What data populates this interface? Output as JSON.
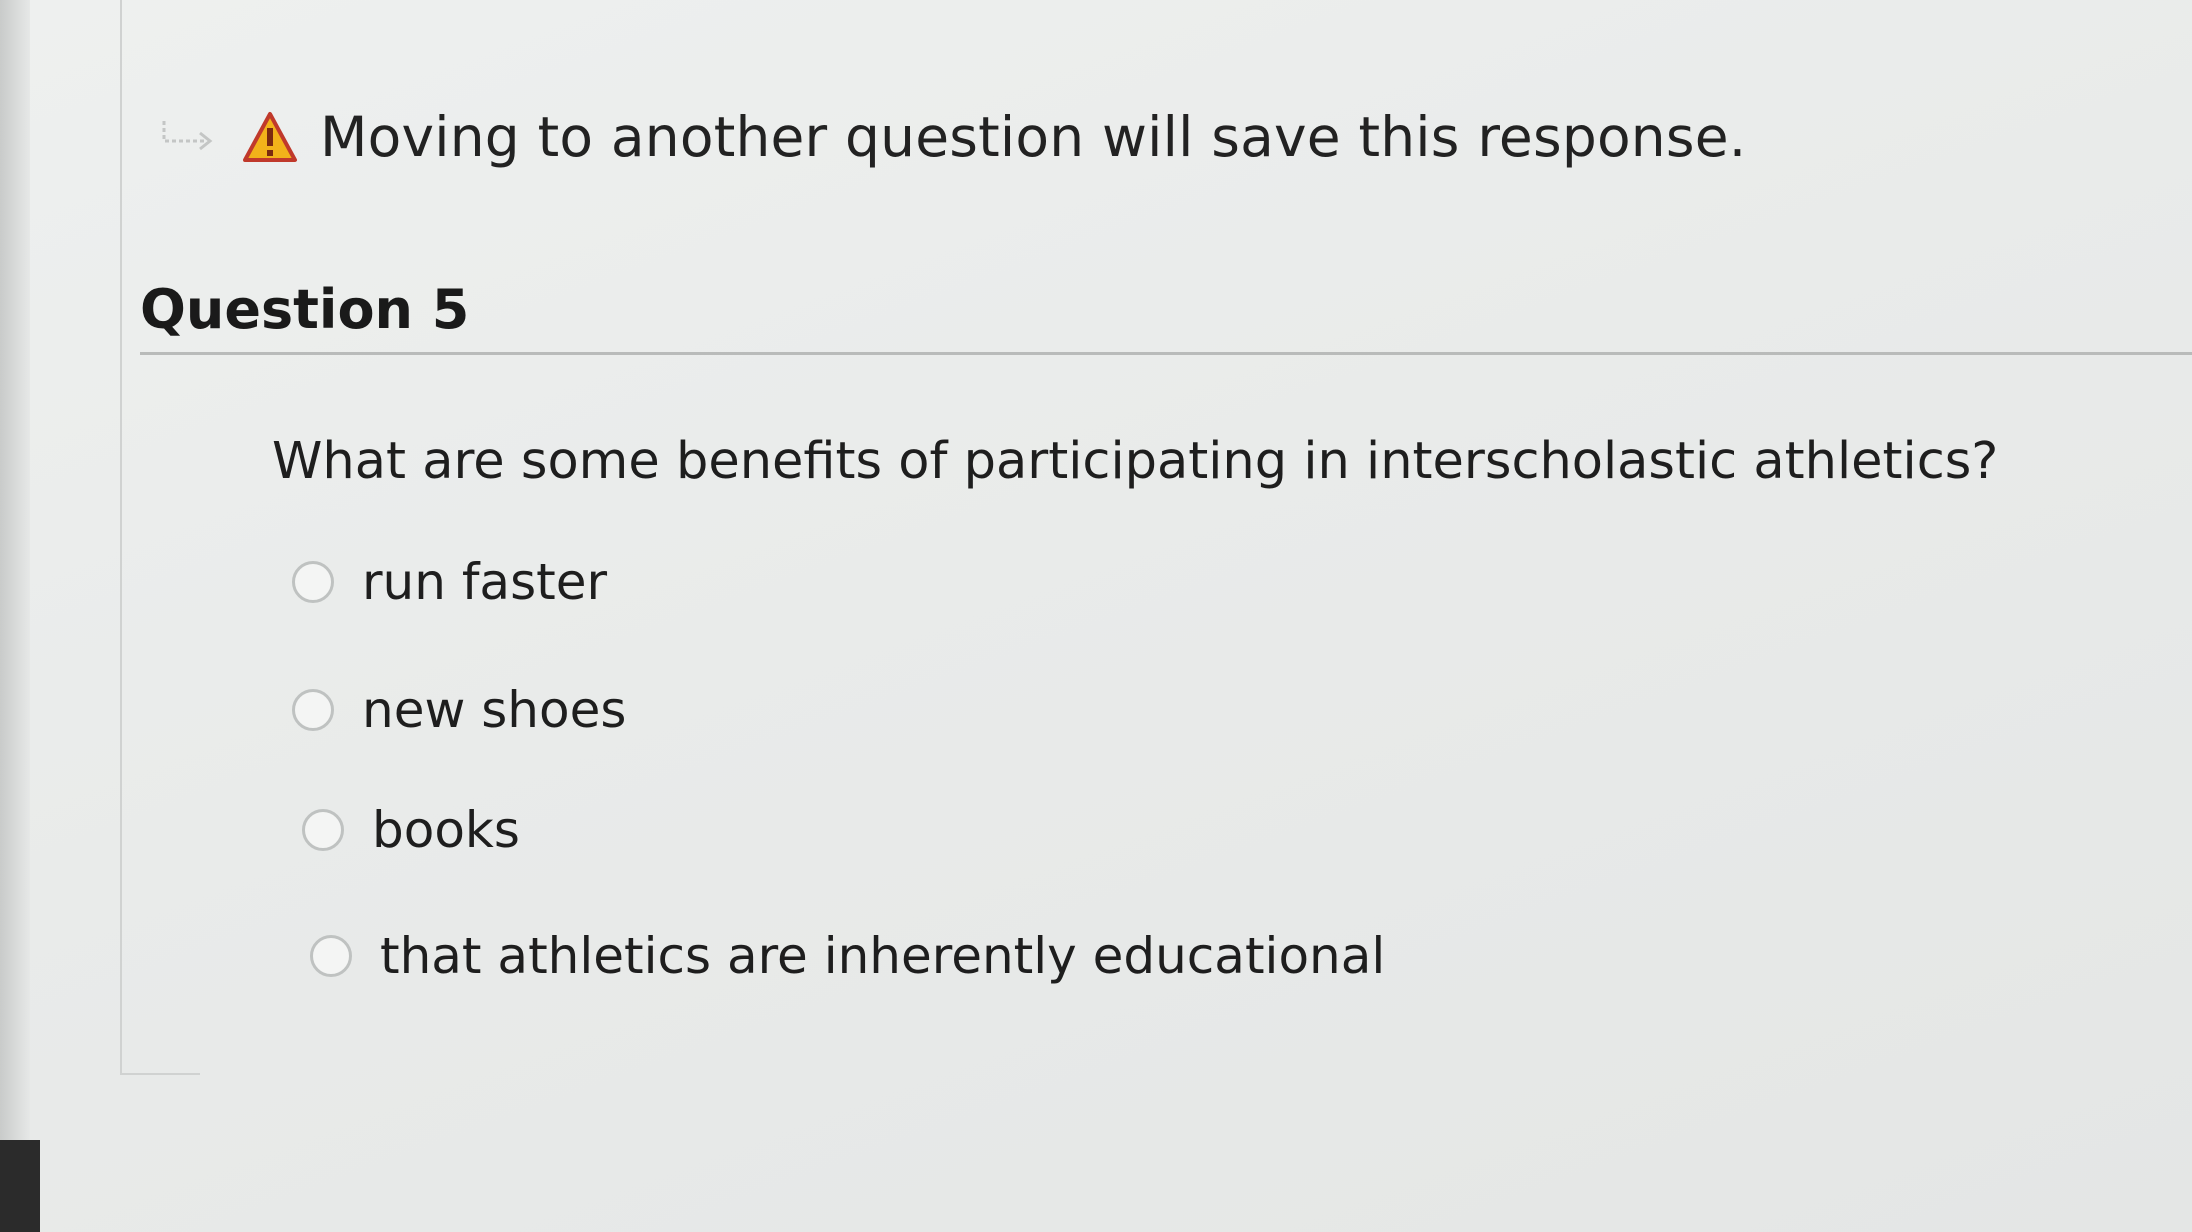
{
  "notice": {
    "icon": "warning-icon",
    "text": "Moving to another question will save this response."
  },
  "question": {
    "heading": "Question 5",
    "prompt": "What are some benefits of participating in interscholastic athletics?",
    "options": [
      {
        "label": "run faster",
        "selected": false
      },
      {
        "label": "new shoes",
        "selected": false
      },
      {
        "label": "books",
        "selected": false
      },
      {
        "label": "that athletics are inherently educational",
        "selected": false
      }
    ]
  },
  "colors": {
    "warning_fill": "#f2b21a",
    "warning_stroke": "#c0392b"
  }
}
